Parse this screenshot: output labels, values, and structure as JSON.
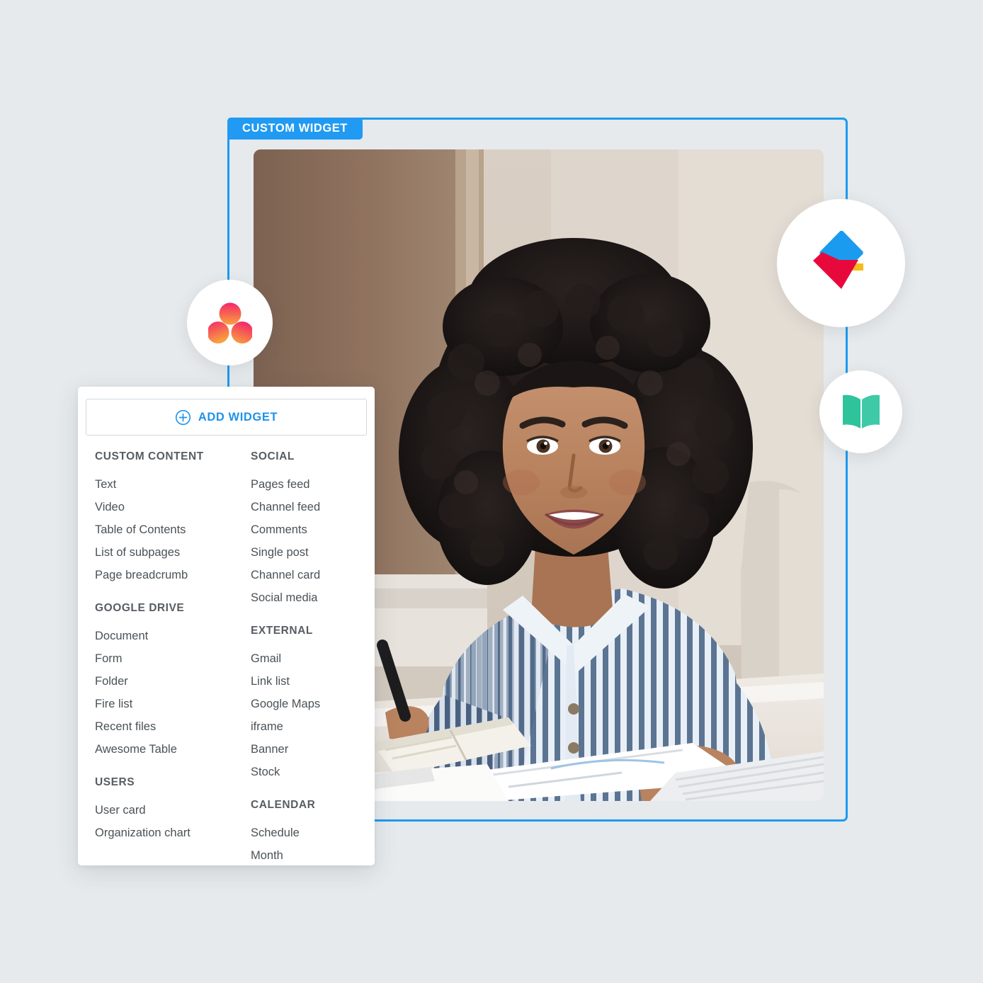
{
  "background_color": "#e6eaec",
  "accent_color": "#1c9bf0",
  "widget_frame": {
    "tab_label": "CUSTOM WIDGET",
    "border_color": "#1c9bf0",
    "tab_color": "#209af2"
  },
  "photo": {
    "alt": "Smiling woman with curly dark hair wearing a blue and white striped shirt, seated at a desk with an open notebook and papers"
  },
  "badges": [
    {
      "name": "asana-logo",
      "colors": [
        "#f95d8f",
        "#f9a03f"
      ]
    },
    {
      "name": "diamond-logo",
      "colors": [
        "#1a9bf0",
        "#e8093c",
        "#f5bc1b"
      ]
    },
    {
      "name": "book-logo",
      "colors": [
        "#2ec39b",
        "#38cca6"
      ]
    }
  ],
  "picker": {
    "add_button": {
      "label": "ADD WIDGET",
      "icon": "circle-plus-icon",
      "color": "#1f93e8"
    },
    "columns": [
      {
        "groups": [
          {
            "title": "CUSTOM CONTENT",
            "items": [
              "Text",
              "Video",
              "Table of Contents",
              "List of subpages",
              "Page breadcrumb"
            ]
          },
          {
            "title": "GOOGLE DRIVE",
            "items": [
              "Document",
              "Form",
              "Folder",
              "Fire list",
              "Recent files",
              "Awesome Table"
            ]
          },
          {
            "title": "USERS",
            "items": [
              "User card",
              "Organization chart"
            ]
          }
        ]
      },
      {
        "groups": [
          {
            "title": "SOCIAL",
            "items": [
              "Pages feed",
              "Channel feed",
              "Comments",
              "Single post",
              "Channel card",
              "Social media"
            ]
          },
          {
            "title": "EXTERNAL",
            "items": [
              "Gmail",
              "Link list",
              "Google Maps",
              "iframe",
              "Banner",
              "Stock"
            ]
          },
          {
            "title": "CALENDAR",
            "items": [
              "Schedule",
              "Month"
            ]
          }
        ]
      }
    ]
  }
}
